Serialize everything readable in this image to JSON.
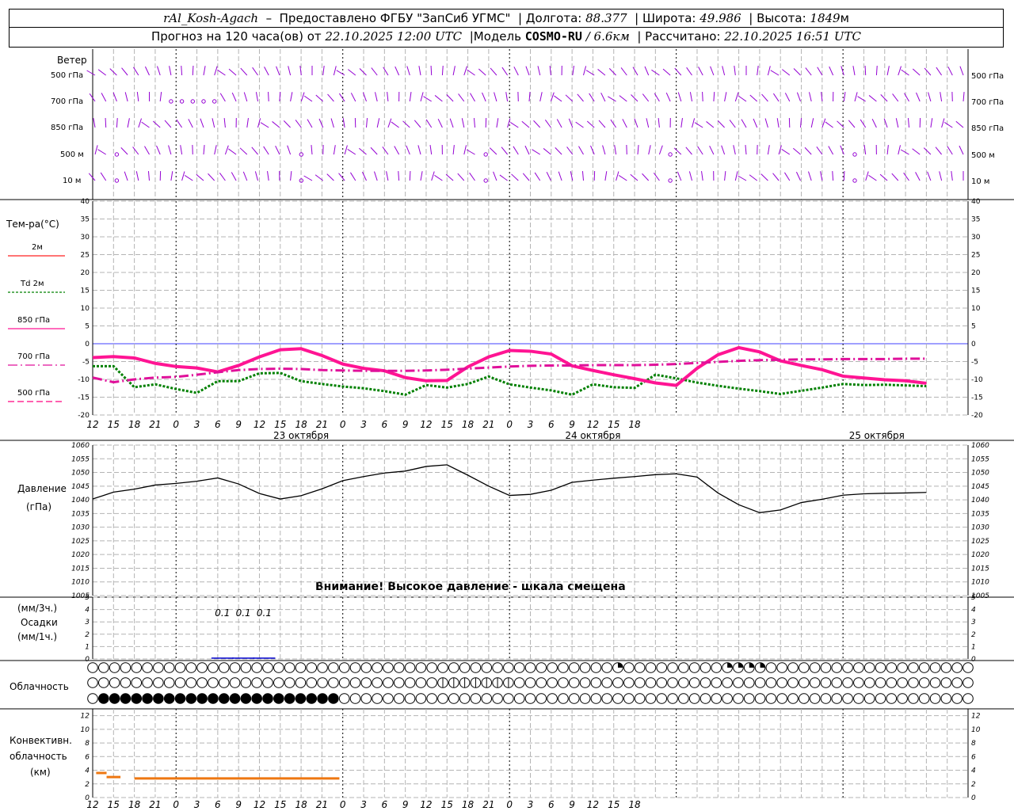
{
  "header": {
    "station": "rAl_Kosh-Agach",
    "provided_prefix": "Предоставлено ФГБУ \"ЗапСиб УГМС\"",
    "lon_label": "Долгота:",
    "lon_value": "88.377",
    "lat_label": "Широта:",
    "lat_value": "49.986",
    "alt_label": "Высота:",
    "alt_value": "1849",
    "alt_unit": "м",
    "forecast_prefix": "Прогноз на 120 часа(ов) от",
    "forecast_start": "22.10.2025 12:00 UTC",
    "model_label": "Модель",
    "model_name": "COSMO-RU",
    "model_res": "/ 6.6км",
    "calc_label": "Рассчитано:",
    "calc_time": "22.10.2025 16:51 UTC"
  },
  "labels": {
    "wind": "Ветер",
    "wind_levels": [
      "500 гПа",
      "700 гПа",
      "850 гПа",
      "500 м",
      "10  м"
    ],
    "temp_title": "Тем-ра(°C)",
    "temp_legend": [
      "2м",
      "Td  2м",
      "850 гПа",
      "700 гПа",
      "500 гПа"
    ],
    "pressure_title": "Давление",
    "pressure_unit": "(гПа)",
    "pressure_warning": "Внимание! Высокое давление - шкала смещена",
    "precip_unit_top": "(мм/3ч.)",
    "precip_title": "Осадки",
    "precip_unit_bottom": "(мм/1ч.)",
    "cloud_title": "Облачность",
    "conv_line1": "Конвективн.",
    "conv_line2": "облачность",
    "conv_unit": "(км)"
  },
  "colors": {
    "t2m": "#ff2020",
    "td2m": "#008000",
    "t850": "#ff1493",
    "t700": "#e0109a",
    "t500": "#ff0080",
    "pressure": "#000000",
    "wind": "#9400d3",
    "precip": "#0000cc",
    "conv": "#ee7711",
    "grid": "#b4b4b4",
    "zero_line": "#4040ff"
  },
  "x_ticks": [
    "12",
    "15",
    "18",
    "21",
    "0",
    "3",
    "6",
    "9",
    "12",
    "15",
    "18",
    "21",
    "0",
    "3",
    "6",
    "9",
    "12",
    "15",
    "18",
    "21",
    "0",
    "3",
    "6",
    "9",
    "12",
    "15",
    "18"
  ],
  "date_labels": [
    "23 октября",
    "24 октября",
    "25 октября"
  ],
  "chart_data": [
    {
      "type": "line",
      "name": "temperature",
      "x_hours": [
        0,
        3,
        6,
        9,
        12,
        15,
        18,
        21,
        24,
        27,
        30,
        33,
        36,
        39,
        42,
        45,
        48,
        51,
        54,
        57,
        60,
        63,
        66,
        69,
        72,
        75,
        78,
        81,
        84,
        87,
        90,
        93,
        96,
        99,
        102,
        105,
        108,
        111,
        114,
        117,
        120
      ],
      "ylim": [
        -20,
        40
      ],
      "yticks": [
        -20,
        -15,
        -10,
        -5,
        0,
        5,
        10,
        15,
        20,
        25,
        30,
        35,
        40
      ],
      "series": [
        {
          "name": "2м",
          "values": [
            -3.8,
            -3.5,
            -3.9,
            -5.4,
            -6.3,
            -6.7,
            -7.8,
            -6.0,
            -3.6,
            -1.6,
            -1.3,
            -3.2,
            -5.6,
            -6.8,
            -7.5,
            -9.4,
            -10.3,
            -10.2,
            -6.4,
            -3.6,
            -1.8,
            -2.0,
            -2.8,
            -6.1,
            -7.4,
            -8.6,
            -9.7,
            -10.9,
            -11.6,
            -6.8,
            -3.0,
            -1.0,
            -2.2,
            -4.7,
            -6.0,
            -7.2,
            -9.0,
            -9.5,
            -10.0,
            -10.3,
            -11.0
          ]
        },
        {
          "name": "Td  2м",
          "values": [
            -6.3,
            -6.3,
            -12.2,
            -11.4,
            -12.7,
            -13.8,
            -10.5,
            -10.5,
            -8.3,
            -8.2,
            -10.5,
            -11.3,
            -12.0,
            -12.5,
            -13.3,
            -14.3,
            -11.6,
            -12.3,
            -11.3,
            -9.2,
            -11.4,
            -12.3,
            -13.1,
            -14.3,
            -11.4,
            -12.2,
            -12.4,
            -8.7,
            -9.7,
            -10.9,
            -11.8,
            -12.6,
            -13.3,
            -14.1,
            -13.2,
            -12.3,
            -11.3,
            -11.6,
            -11.5,
            -11.7,
            -11.9
          ]
        },
        {
          "name": "850 гПа",
          "values": [
            -3.9,
            -3.6,
            -4.0,
            -5.5,
            -6.4,
            -6.8,
            -7.9,
            -6.1,
            -3.7,
            -1.7,
            -1.4,
            -3.3,
            -5.7,
            -6.9,
            -7.6,
            -9.5,
            -10.4,
            -10.3,
            -6.5,
            -3.7,
            -1.9,
            -2.1,
            -2.9,
            -6.2,
            -7.5,
            -8.7,
            -9.8,
            -11.0,
            -11.7,
            -6.9,
            -3.1,
            -1.1,
            -2.3,
            -4.8,
            -6.1,
            -7.3,
            -9.1,
            -9.6,
            -10.1,
            -10.4,
            -11.1
          ]
        },
        {
          "name": "700 гПа",
          "values": [
            -9.5,
            -10.8,
            -10.0,
            -9.5,
            -9.3,
            -8.7,
            -8.0,
            -7.4,
            -7.1,
            -7.0,
            -7.1,
            -7.4,
            -7.5,
            -7.6,
            -7.6,
            -7.6,
            -7.5,
            -7.3,
            -7.0,
            -6.7,
            -6.4,
            -6.2,
            -6.1,
            -6.1,
            -6.0,
            -6.0,
            -6.0,
            -5.9,
            -5.7,
            -5.4,
            -5.1,
            -4.8,
            -4.6,
            -4.5,
            -4.4,
            -4.4,
            -4.3,
            -4.3,
            -4.3,
            -4.2,
            -4.2
          ]
        },
        {
          "name": "500 гПа",
          "values": []
        }
      ]
    },
    {
      "type": "line",
      "name": "pressure",
      "x_hours": [
        0,
        3,
        6,
        9,
        12,
        15,
        18,
        21,
        24,
        27,
        30,
        33,
        36,
        39,
        42,
        45,
        48,
        51,
        54,
        57,
        60,
        63,
        66,
        69,
        72,
        75,
        78,
        81,
        84,
        87,
        90,
        93,
        96,
        99,
        102,
        105,
        108,
        111,
        114,
        117,
        120
      ],
      "ylim": [
        1005,
        1060
      ],
      "yticks": [
        1005,
        1010,
        1015,
        1020,
        1025,
        1030,
        1035,
        1040,
        1045,
        1050,
        1055,
        1060
      ],
      "series": [
        {
          "name": "Давление",
          "values": [
            1040.3,
            1042.8,
            1043.9,
            1045.4,
            1046.0,
            1046.8,
            1048.0,
            1045.8,
            1042.3,
            1040.3,
            1041.5,
            1044.0,
            1047.0,
            1048.5,
            1049.8,
            1050.5,
            1052.2,
            1052.8,
            1049.0,
            1045.0,
            1041.6,
            1042.0,
            1043.5,
            1046.4,
            1047.2,
            1047.9,
            1048.5,
            1049.2,
            1049.5,
            1048.3,
            1042.5,
            1038.2,
            1035.3,
            1036.3,
            1039.0,
            1040.2,
            1041.7,
            1042.2,
            1042.4,
            1042.5,
            1042.7
          ]
        }
      ]
    },
    {
      "type": "bar",
      "name": "precipitation",
      "ylim": [
        0,
        5
      ],
      "yticks": [
        0,
        1,
        2,
        3,
        4,
        5
      ],
      "annotations": [
        {
          "x_hour": 18,
          "label": "0.1"
        },
        {
          "x_hour": 21,
          "label": "0.1"
        },
        {
          "x_hour": 24,
          "label": "0.1"
        }
      ],
      "values_hourly_hint": "only 0.1 mm/3h totals around 18–24 UTC, rest zero"
    },
    {
      "type": "table",
      "name": "cloud_cover",
      "rows": [
        "upper",
        "middle",
        "lower"
      ],
      "step_hours": 1.5,
      "cells": 81,
      "lower_overcast_range_hours": [
        0,
        33
      ],
      "middle_partial_range_hours": [
        48,
        58
      ],
      "upper_partial_points_hours": [
        72,
        87,
        89,
        90,
        91
      ]
    },
    {
      "type": "bar",
      "name": "convective_cloud",
      "ylim": [
        0,
        13
      ],
      "yticks": [
        0,
        2,
        4,
        6,
        8,
        10,
        12
      ],
      "segments": [
        {
          "from_hour": 0.5,
          "to_hour": 2,
          "top_km": 3.6
        },
        {
          "from_hour": 2,
          "to_hour": 4,
          "top_km": 3.0
        },
        {
          "from_hour": 6,
          "to_hour": 33,
          "top_km": 2.8
        }
      ]
    }
  ]
}
